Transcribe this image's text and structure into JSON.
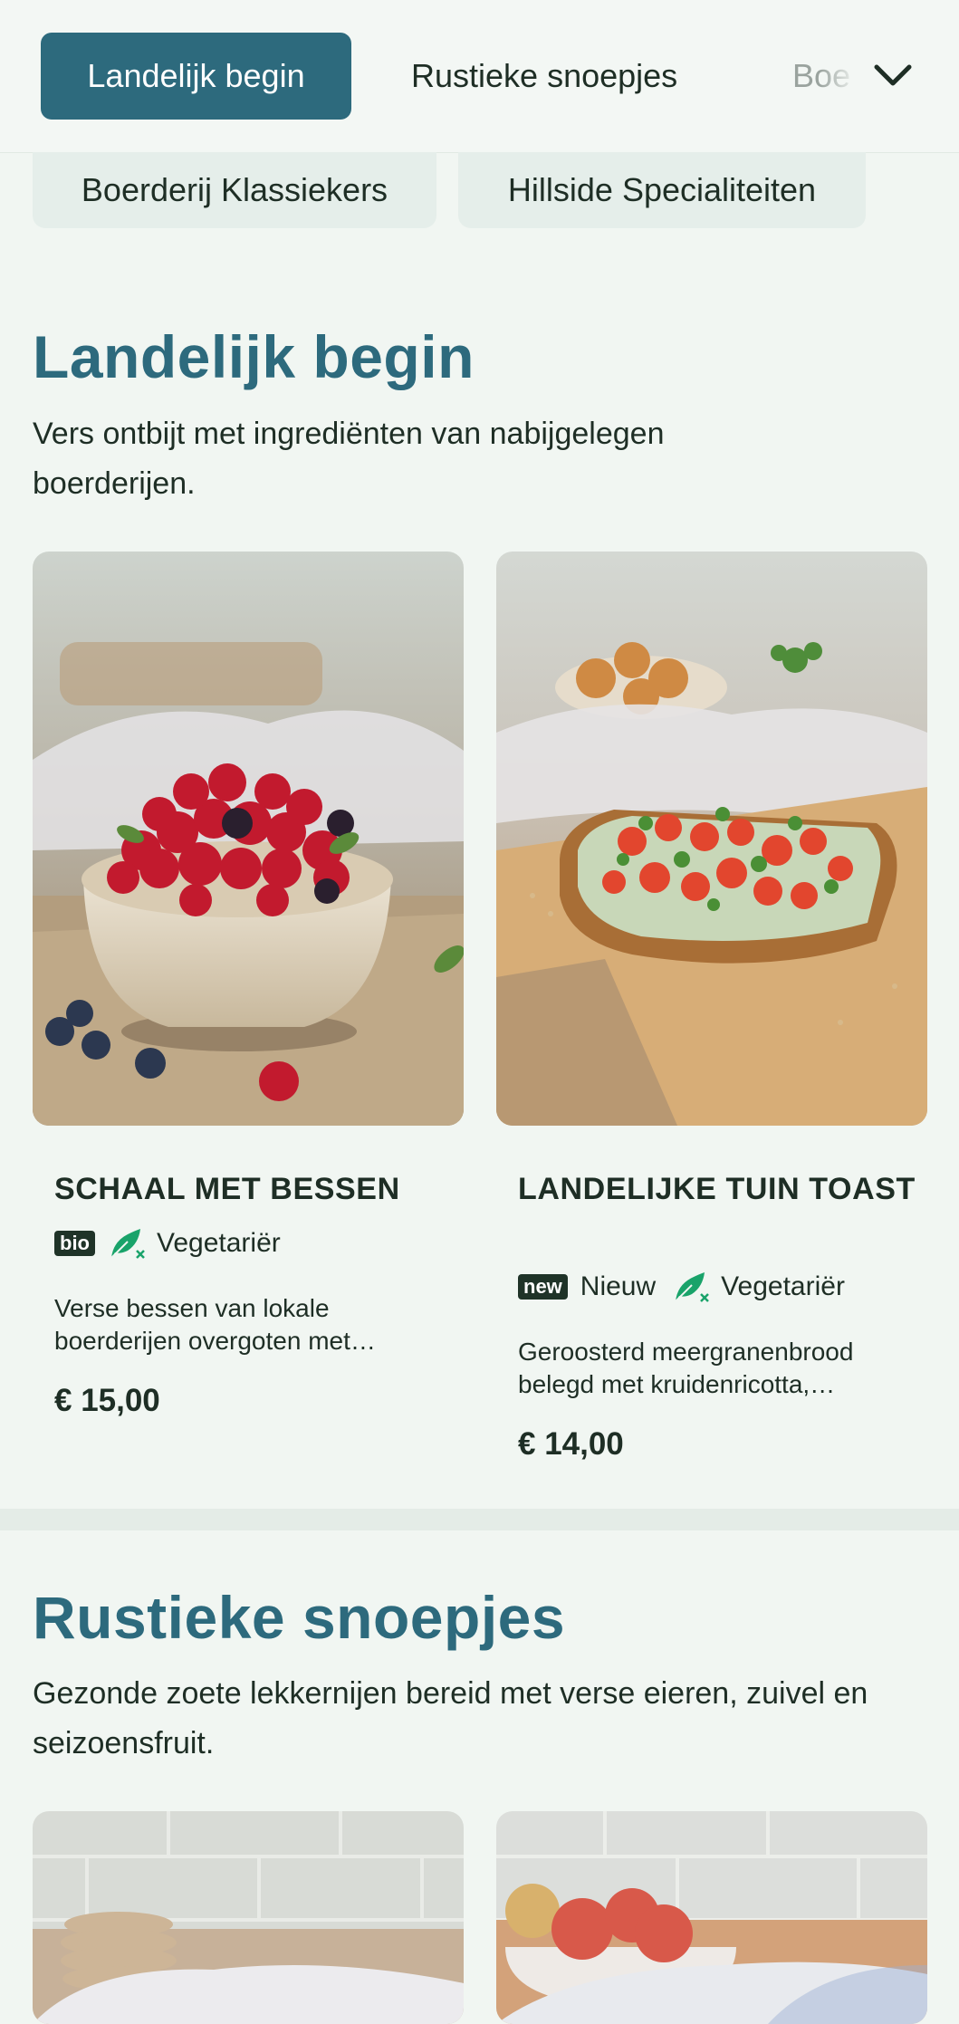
{
  "categories": {
    "active": "Landelijk begin",
    "items": [
      "Rustieke snoepjes",
      "Boe"
    ],
    "chips": [
      "Boerderij Klassiekers",
      "Hillside Specialiteiten"
    ]
  },
  "sections": [
    {
      "title": "Landelijk begin",
      "description": "Vers ontbijt met ingrediënten van nabijgelegen boerderijen.",
      "cards": [
        {
          "name": "SCHAAL MET BESSEN",
          "badge": "bio",
          "tags": [
            "Vegetariër"
          ],
          "description": "Verse bessen van lokale boerderijen overgoten met…",
          "price": "€ 15,00"
        },
        {
          "name": "LANDELIJKE TUIN TOAST",
          "badge": "new",
          "tags": [
            "Nieuw",
            "Vegetariër"
          ],
          "description": "Geroosterd meergranenbrood belegd met kruidenricotta,…",
          "price": "€ 14,00"
        }
      ]
    },
    {
      "title": "Rustieke snoepjes",
      "description": "Gezonde zoete lekkernijen bereid met verse eieren, zuivel en seizoensfruit."
    }
  ],
  "colors": {
    "accent": "#2d6a7d",
    "background": "#f1f6f2",
    "leaf": "#19a36a",
    "badge": "#1f3328"
  },
  "icons": [
    "chevron-down-icon",
    "vegetarian-leaf-icon"
  ]
}
